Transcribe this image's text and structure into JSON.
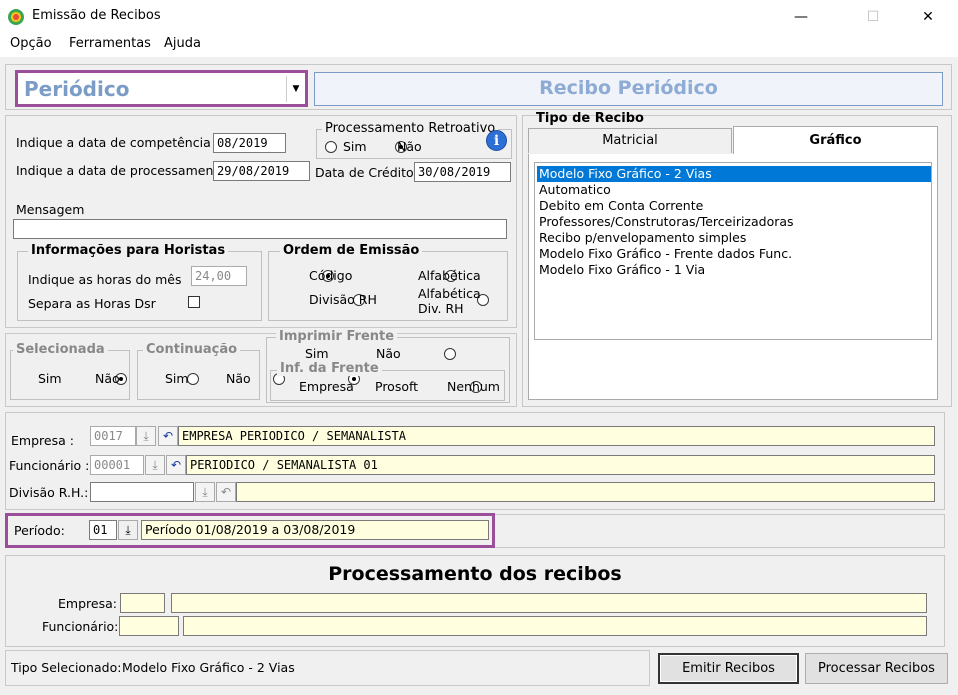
{
  "window": {
    "title": "Emissão de Recibos",
    "minimize": "—",
    "maximize": "☐",
    "close": "✕"
  },
  "menu": [
    "Opção",
    "Ferramentas",
    "Ajuda"
  ],
  "top": {
    "tipo_value": "Periódico",
    "header_title": "Recibo Periódico"
  },
  "dates": {
    "competencia_label": "Indique a data de competência",
    "competencia_value": "08/2019",
    "processamento_label": "Indique a data de processamento",
    "processamento_value": "29/08/2019",
    "credito_label": "Data de Crédito",
    "credito_value": "30/08/2019",
    "mensagem_label": "Mensagem",
    "mensagem_value": ""
  },
  "retroativo": {
    "title": "Processamento Retroativo",
    "sim": "Sim",
    "nao": "Não",
    "selected": "Não",
    "info_icon": "i"
  },
  "horistas": {
    "title": "Informações para Horistas",
    "horas_label": "Indique as horas do mês",
    "horas_value": "24,00",
    "dsr_label": "Separa as Horas Dsr"
  },
  "ordem": {
    "title": "Ordem de Emissão",
    "codigo": "Código",
    "alfabetica": "Alfabética",
    "divisao": "Divisão RH",
    "alfa_div_1": "Alfabética",
    "alfa_div_2": "Div.  RH",
    "selected": "Código"
  },
  "selecionada": {
    "title": "Selecionada",
    "sim": "Sim",
    "nao": "Não",
    "selected": "Sim"
  },
  "continuacao": {
    "title": "Continuação",
    "sim": "Sim",
    "nao": "Não",
    "selected": "Não"
  },
  "imprimir_frente": {
    "title": "Imprimir Frente",
    "sim": "Sim",
    "nao": "Não",
    "selected": "Não"
  },
  "inf_frente": {
    "title": "Inf. da Frente",
    "empresa": "Empresa",
    "prosoft": "Prosoft",
    "nenhum": "Nenhum",
    "selected": "Nenhum"
  },
  "tipo_recibo": {
    "title": "Tipo de Recibo",
    "tabs": [
      "Matricial",
      "Gráfico"
    ],
    "active_tab": "Gráfico",
    "items": [
      "Modelo Fixo Gráfico - 2 Vias",
      "Automatico",
      "Debito em Conta Corrente",
      "Professores/Construtoras/Terceirizadoras",
      "Recibo p/envelopamento simples",
      "Modelo Fixo Gráfico - Frente dados Func.",
      "Modelo Fixo Gráfico - 1 Via"
    ],
    "selected_index": 0
  },
  "selection": {
    "empresa_label": "Empresa :",
    "empresa_code": "0017",
    "empresa_name": "EMPRESA PERIODICO / SEMANALISTA",
    "func_label": "Funcionário :",
    "func_code": "00001",
    "func_name": "PERIODICO / SEMANALISTA 01",
    "divisao_label": "Divisão R.H.:",
    "divisao_code": "",
    "divisao_name": ""
  },
  "periodo": {
    "label": "Período:",
    "code": "01",
    "text": "Período 01/08/2019 a 03/08/2019"
  },
  "processamento": {
    "title": "Processamento dos recibos",
    "empresa_label": "Empresa:",
    "func_label": "Funcionário:"
  },
  "footer": {
    "tipo_label": "Tipo Selecionado:",
    "tipo_value": "Modelo Fixo Gráfico - 2 Vias",
    "emitir": "Emitir Recibos",
    "processar": "Processar Recibos"
  },
  "colors": {
    "highlight_border": "#9b4f9b",
    "selection_blue": "#0078d7",
    "header_text": "#7a9cc6",
    "field_yellow": "#ffffe0"
  }
}
